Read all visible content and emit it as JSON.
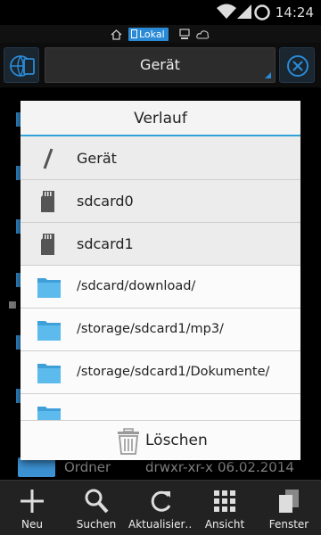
{
  "status_bar": {
    "time": "14:24",
    "icons": [
      "wifi-icon",
      "signal-icon",
      "circle-icon"
    ]
  },
  "location_bar": {
    "active_label": "Lokal",
    "icons": [
      "home-icon",
      "sdcard-icon",
      "computer-icon",
      "cloud-icon"
    ]
  },
  "toolbar": {
    "location": "Gerät",
    "left_icon": "split-screen-icon",
    "right_icon": "close-icon"
  },
  "background_list": {
    "row_type": "Ordner",
    "row_permissions": "drwxr-xr-x",
    "row_date": "06.02.2014"
  },
  "dialog": {
    "title": "Verlauf",
    "items": [
      {
        "label": "Gerät",
        "icon": "slash-icon",
        "path": false
      },
      {
        "label": "sdcard0",
        "icon": "sdcard-icon",
        "path": false
      },
      {
        "label": "sdcard1",
        "icon": "sdcard-icon",
        "path": false
      },
      {
        "label": "/sdcard/download/",
        "icon": "folder-icon",
        "path": true
      },
      {
        "label": "/storage/sdcard1/mp3/",
        "icon": "folder-icon",
        "path": true
      },
      {
        "label": "/storage/sdcard1/Dokumente/",
        "icon": "folder-icon",
        "path": true
      }
    ],
    "clear_label": "Löschen"
  },
  "bottom_bar": {
    "items": [
      {
        "label": "Neu",
        "icon": "plus-icon"
      },
      {
        "label": "Suchen",
        "icon": "search-icon"
      },
      {
        "label": "Aktualisier…",
        "icon": "refresh-icon"
      },
      {
        "label": "Ansicht",
        "icon": "grid-icon"
      },
      {
        "label": "Fenster",
        "icon": "windows-icon"
      }
    ]
  },
  "colors": {
    "accent": "#31a3d6",
    "folder": "#4fb6e8",
    "background": "#000000",
    "dialog": "#ececec"
  }
}
